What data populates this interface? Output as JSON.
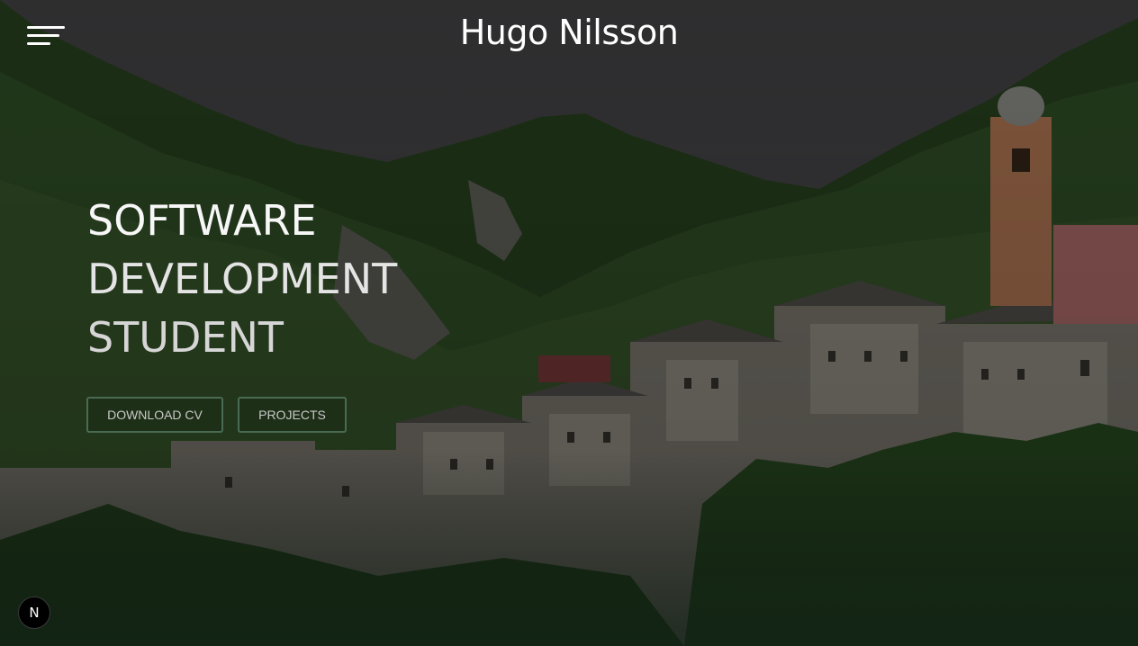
{
  "header": {
    "title": "Hugo Nilsson",
    "menu_icon": "hamburger-menu-icon"
  },
  "hero": {
    "headline_lines": [
      "SOFTWARE",
      "DEVELOPMENT",
      "STUDENT"
    ],
    "buttons": {
      "download_cv": "DOWNLOAD CV",
      "projects": "PROJECTS"
    },
    "background": "mountain-village-photo"
  },
  "badge": {
    "label": "N",
    "icon": "nextjs-dev-indicator-icon"
  },
  "colors": {
    "title": "#ffffff",
    "button_border": "#4a6b53",
    "button_text": "#c8c8c8",
    "bottom_tint": "#1b2a20"
  }
}
